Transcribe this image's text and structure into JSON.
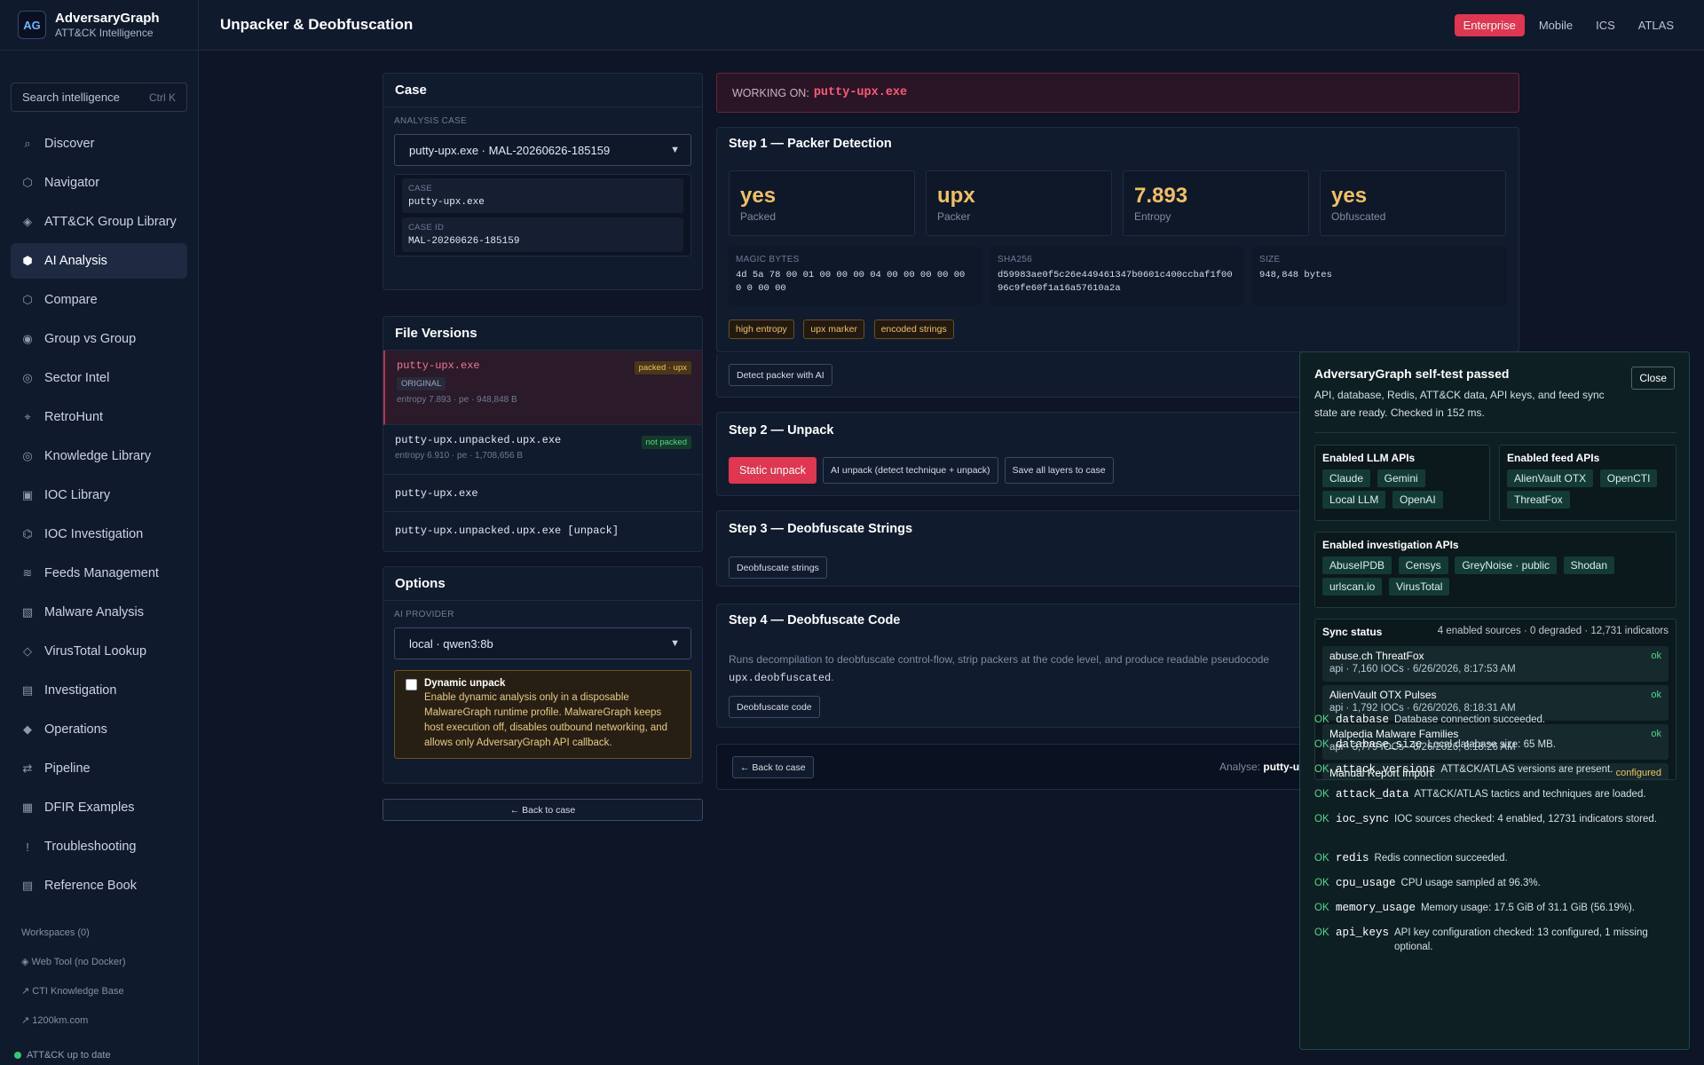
{
  "app": {
    "name": "AdversaryGraph",
    "subtitle": "ATT&CK Intelligence",
    "logo": "AG"
  },
  "search": {
    "placeholder": "Search intelligence",
    "shortcut": "Ctrl K"
  },
  "nav": [
    {
      "label": "Discover",
      "icon": "⌕"
    },
    {
      "label": "Navigator",
      "icon": "⬡"
    },
    {
      "label": "ATT&CK Group Library",
      "icon": "◈"
    },
    {
      "label": "AI Analysis",
      "icon": "⬢"
    },
    {
      "label": "Compare",
      "icon": "⬡"
    },
    {
      "label": "Group vs Group",
      "icon": "◉"
    },
    {
      "label": "Sector Intel",
      "icon": "◎"
    },
    {
      "label": "RetroHunt",
      "icon": "⌖"
    },
    {
      "label": "Knowledge Library",
      "icon": "◎"
    },
    {
      "label": "IOC Library",
      "icon": "▣"
    },
    {
      "label": "IOC Investigation",
      "icon": "⌬"
    },
    {
      "label": "Feeds Management",
      "icon": "≋"
    },
    {
      "label": "Malware Analysis",
      "icon": "▧"
    },
    {
      "label": "VirusTotal Lookup",
      "icon": "◇"
    },
    {
      "label": "Investigation",
      "icon": "▤"
    },
    {
      "label": "Operations",
      "icon": "◆"
    },
    {
      "label": "Pipeline",
      "icon": "⇄"
    },
    {
      "label": "DFIR Examples",
      "icon": "▦"
    },
    {
      "label": "Troubleshooting",
      "icon": "!"
    },
    {
      "label": "Reference Book",
      "icon": "▤"
    }
  ],
  "sidebar_footer": {
    "workspaces": "Workspaces (0)",
    "web_tool": "◈ Web Tool (no Docker)",
    "cti_kb": "↗ CTI Knowledge Base",
    "site": "↗ 1200km.com",
    "status": "ATT&CK up to date"
  },
  "topbar": {
    "title": "Unpacker & Deobfuscation",
    "tabs": [
      "Enterprise",
      "Mobile",
      "ICS",
      "ATLAS"
    ]
  },
  "case": {
    "title": "Case",
    "analysis_case_label": "ANALYSIS CASE",
    "selected": "putty-upx.exe · MAL-20260626-185159",
    "case_label": "CASE",
    "case_value": "putty-upx.exe",
    "case_id_label": "CASE ID",
    "case_id_value": "MAL-20260626-185159"
  },
  "file_versions": {
    "title": "File Versions",
    "items": [
      {
        "name": "putty-upx.exe",
        "tag": "ORIGINAL",
        "badge": "packed · upx",
        "meta": "entropy 7.893 · pe · 948,848 B"
      },
      {
        "name": "putty-upx.unpacked.upx.exe",
        "badge": "not packed",
        "meta": "entropy 6.910 · pe · 1,708,656 B"
      },
      {
        "name": "putty-upx.exe"
      },
      {
        "name": "putty-upx.unpacked.upx.exe [unpack]"
      }
    ]
  },
  "options": {
    "title": "Options",
    "provider_label": "AI PROVIDER",
    "provider_value": "local · qwen3:8b",
    "dynamic_title": "Dynamic unpack",
    "dynamic_text": "Enable dynamic analysis only in a disposable MalwareGraph runtime profile. MalwareGraph keeps host execution off, disables outbound networking, and allows only AdversaryGraph API callback.",
    "back": "← Back to case"
  },
  "working": {
    "label": "WORKING ON:",
    "file": "putty-upx.exe"
  },
  "step1": {
    "title": "Step 1 — Packer Detection",
    "stats": [
      {
        "value": "yes",
        "label": "Packed"
      },
      {
        "value": "upx",
        "label": "Packer"
      },
      {
        "value": "7.893",
        "label": "Entropy"
      },
      {
        "value": "yes",
        "label": "Obfuscated"
      }
    ],
    "magic_label": "MAGIC BYTES",
    "magic_value": "4d 5a 78 00 01 00 00 00 04 00 00 00 00 00 0 0 00 00",
    "sha_label": "SHA256",
    "sha_value": "d59983ae0f5c26e449461347b0601c400ccbaf1f0096c9fe60f1a16a57610a2a",
    "size_label": "SIZE",
    "size_value": "948,848 bytes",
    "indicators": [
      "high entropy",
      "upx marker",
      "encoded strings"
    ],
    "detect_button": "Detect packer with AI"
  },
  "step2": {
    "title": "Step 2 — Unpack",
    "static": "Static unpack",
    "ai": "AI unpack (detect technique + unpack)",
    "save": "Save all layers to case"
  },
  "step3": {
    "title": "Step 3 — Deobfuscate Strings",
    "button": "Deobfuscate strings"
  },
  "step4": {
    "title": "Step 4 — Deobfuscate Code",
    "desc": "Runs decompilation to deobfuscate control-flow, strip packers at the code level, and produce readable pseudocode",
    "file": "upx.deobfuscated",
    "tail": ".",
    "button": "Deobfuscate code"
  },
  "bottom": {
    "back": "← Back to case",
    "analyse_label": "Analyse:",
    "analyse_file": "putty-u"
  },
  "selftest": {
    "title": "AdversaryGraph self-test passed",
    "desc": "API, database, Redis, ATT&CK data, API keys, and feed sync state are ready. Checked in 152 ms.",
    "close": "Close",
    "llm_title": "Enabled LLM APIs",
    "llm": [
      "Claude",
      "Gemini",
      "Local LLM",
      "OpenAI"
    ],
    "feed_title": "Enabled feed APIs",
    "feeds": [
      "AlienVault OTX",
      "OpenCTI",
      "ThreatFox"
    ],
    "inv_title": "Enabled investigation APIs",
    "inv": [
      "AbuseIPDB",
      "Censys",
      "GreyNoise · public",
      "Shodan",
      "urlscan.io",
      "VirusTotal"
    ],
    "sync_title": "Sync status",
    "sync_summary": "4 enabled sources · 0 degraded · 12,731 indicators",
    "sync": [
      {
        "name": "abuse.ch ThreatFox",
        "meta": "api · 7,160 IOCs · 6/26/2026, 8:17:53 AM",
        "status": "ok"
      },
      {
        "name": "AlienVault OTX Pulses",
        "meta": "api · 1,792 IOCs · 6/26/2026, 8:18:31 AM",
        "status": "ok"
      },
      {
        "name": "Malpedia Malware Families",
        "meta": "api · 3,779 IOCs · 6/26/2026, 8:18:26 AM",
        "status": "ok"
      },
      {
        "name": "Manual Report Import",
        "meta": "",
        "status": "configured"
      }
    ],
    "checks": [
      {
        "status": "OK",
        "key": "database",
        "msg": "Database connection succeeded."
      },
      {
        "status": "OK",
        "key": "database_size",
        "msg": "Local database size: 65 MB."
      },
      {
        "status": "OK",
        "key": "attack_versions",
        "msg": "ATT&CK/ATLAS versions are present."
      },
      {
        "status": "OK",
        "key": "attack_data",
        "msg": "ATT&CK/ATLAS tactics and techniques are loaded."
      },
      {
        "status": "OK",
        "key": "ioc_sync",
        "msg": "IOC sources checked: 4 enabled, 12731 indicators stored."
      },
      {
        "status": "OK",
        "key": "redis",
        "msg": "Redis connection succeeded."
      },
      {
        "status": "OK",
        "key": "cpu_usage",
        "msg": "CPU usage sampled at 96.3%."
      },
      {
        "status": "OK",
        "key": "memory_usage",
        "msg": "Memory usage: 17.5 GiB of 31.1 GiB (56.19%)."
      },
      {
        "status": "OK",
        "key": "api_keys",
        "msg": "API key configuration checked: 13 configured, 1 missing optional."
      }
    ]
  }
}
